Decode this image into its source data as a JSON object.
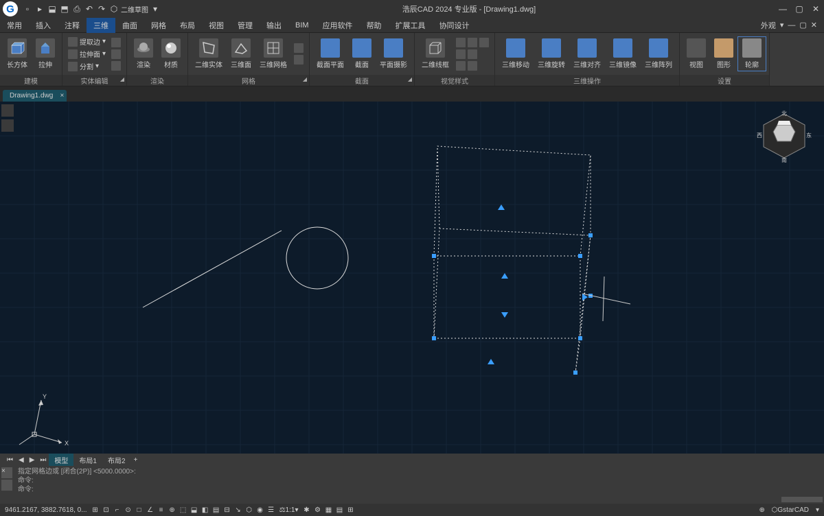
{
  "title": "浩辰CAD 2024 专业版 - [Drawing1.dwg]",
  "qat_dropdown": "二维草图",
  "menubar": {
    "items": [
      "常用",
      "插入",
      "注释",
      "三维",
      "曲面",
      "网格",
      "布局",
      "视图",
      "管理",
      "输出",
      "BIM",
      "应用软件",
      "帮助",
      "扩展工具",
      "协同设计"
    ],
    "active_index": 3,
    "right_label": "外观"
  },
  "ribbon": {
    "groups": [
      {
        "label": "建模",
        "tools": [
          {
            "name": "长方体"
          },
          {
            "name": "拉伸"
          }
        ]
      },
      {
        "label": "实体编辑",
        "small": [
          {
            "name": "提取边"
          },
          {
            "name": "拉伸面"
          },
          {
            "name": "分割"
          }
        ]
      },
      {
        "label": "渲染",
        "tools": [
          {
            "name": "渲染"
          },
          {
            "name": "材质"
          }
        ]
      },
      {
        "label": "网格",
        "tools": [
          {
            "name": "二维实体"
          },
          {
            "name": "三维面"
          },
          {
            "name": "三维网格"
          }
        ]
      },
      {
        "label": "截面",
        "tools": [
          {
            "name": "截面平面"
          },
          {
            "name": "截面"
          },
          {
            "name": "平面摄影"
          }
        ]
      },
      {
        "label": "视觉样式",
        "tools": [
          {
            "name": "二维线框"
          }
        ]
      },
      {
        "label": "三维操作",
        "tools": [
          {
            "name": "三维移动"
          },
          {
            "name": "三维旋转"
          },
          {
            "name": "三维对齐"
          },
          {
            "name": "三维镜像"
          },
          {
            "name": "三维阵列"
          }
        ]
      },
      {
        "label": "设置",
        "tools": [
          {
            "name": "视图"
          },
          {
            "name": "图形"
          },
          {
            "name": "轮廓"
          }
        ]
      }
    ]
  },
  "file_tab": "Drawing1.dwg",
  "layout": {
    "tabs": [
      "模型",
      "布局1",
      "布局2"
    ],
    "active": 0
  },
  "viewcube": {
    "n": "北",
    "s": "南",
    "e": "东",
    "w": "西"
  },
  "command": {
    "history": "指定网格边或 [闭合(2P)] <5000.0000>:",
    "prompt1": "命令:",
    "prompt2": "命令:"
  },
  "status": {
    "coords": "9461.2167, 3882.7618, 0...",
    "scale": "1:1",
    "branding": "GstarCAD"
  },
  "ucs_labels": {
    "x": "X",
    "y": "Y"
  }
}
